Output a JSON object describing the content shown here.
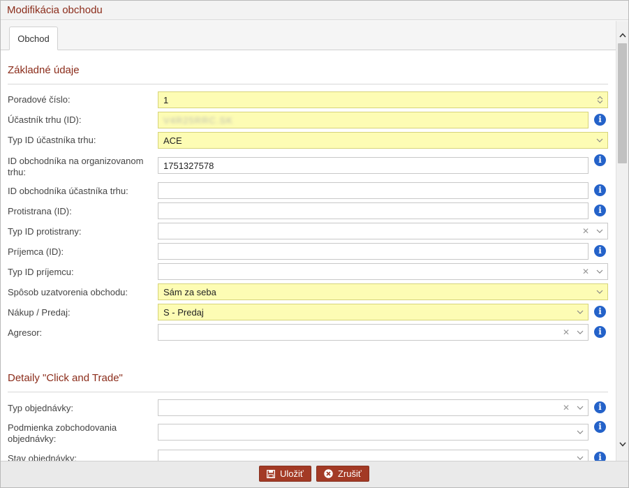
{
  "dialog": {
    "title": "Modifikácia obchodu"
  },
  "tabs": [
    {
      "label": "Obchod"
    }
  ],
  "sections": {
    "basic": {
      "title": "Základné údaje"
    },
    "click_trade": {
      "title": "Detaily \"Click and Trade\""
    }
  },
  "fields": {
    "poradove_cislo": {
      "label": "Poradové číslo:",
      "value": "1"
    },
    "ucastnik_trhu": {
      "label": "Účastník trhu (ID):",
      "value": "V4R25RRC.SK"
    },
    "typ_id_ucastnika": {
      "label": "Typ ID účastníka trhu:",
      "value": "ACE"
    },
    "id_obchodnika_org": {
      "label": "ID obchodníka na organizovanom trhu:",
      "value": "1751327578"
    },
    "id_obchodnika_ucastnika": {
      "label": "ID obchodníka účastníka trhu:",
      "value": ""
    },
    "protistrana": {
      "label": "Protistrana (ID):",
      "value": ""
    },
    "typ_id_protistrany": {
      "label": "Typ ID protistrany:",
      "value": ""
    },
    "prijemca": {
      "label": "Príjemca (ID):",
      "value": ""
    },
    "typ_id_prijemcu": {
      "label": "Typ ID príjemcu:",
      "value": ""
    },
    "sposob_uzatvorenia": {
      "label": "Spôsob uzatvorenia obchodu:",
      "value": "Sám za seba"
    },
    "nakup_predaj": {
      "label": "Nákup / Predaj:",
      "value": "S - Predaj"
    },
    "agresor": {
      "label": "Agresor:",
      "value": ""
    },
    "typ_objednavky": {
      "label": "Typ objednávky:",
      "value": ""
    },
    "podmienka": {
      "label": "Podmienka zobchodovania objednávky:",
      "value": ""
    },
    "stav_objednavky": {
      "label": "Stav objednávky:",
      "value": ""
    }
  },
  "footer": {
    "save_label": "Uložiť",
    "cancel_label": "Zrušiť"
  },
  "colors": {
    "accent": "#8b2c1a",
    "button": "#a33a25",
    "highlight": "#fdfcb4",
    "info": "#2462c9"
  },
  "icons": [
    "info-icon",
    "chevron-down-icon",
    "clear-icon",
    "spinner-icon",
    "save-icon",
    "cancel-icon",
    "scroll-up-icon",
    "scroll-down-icon"
  ]
}
